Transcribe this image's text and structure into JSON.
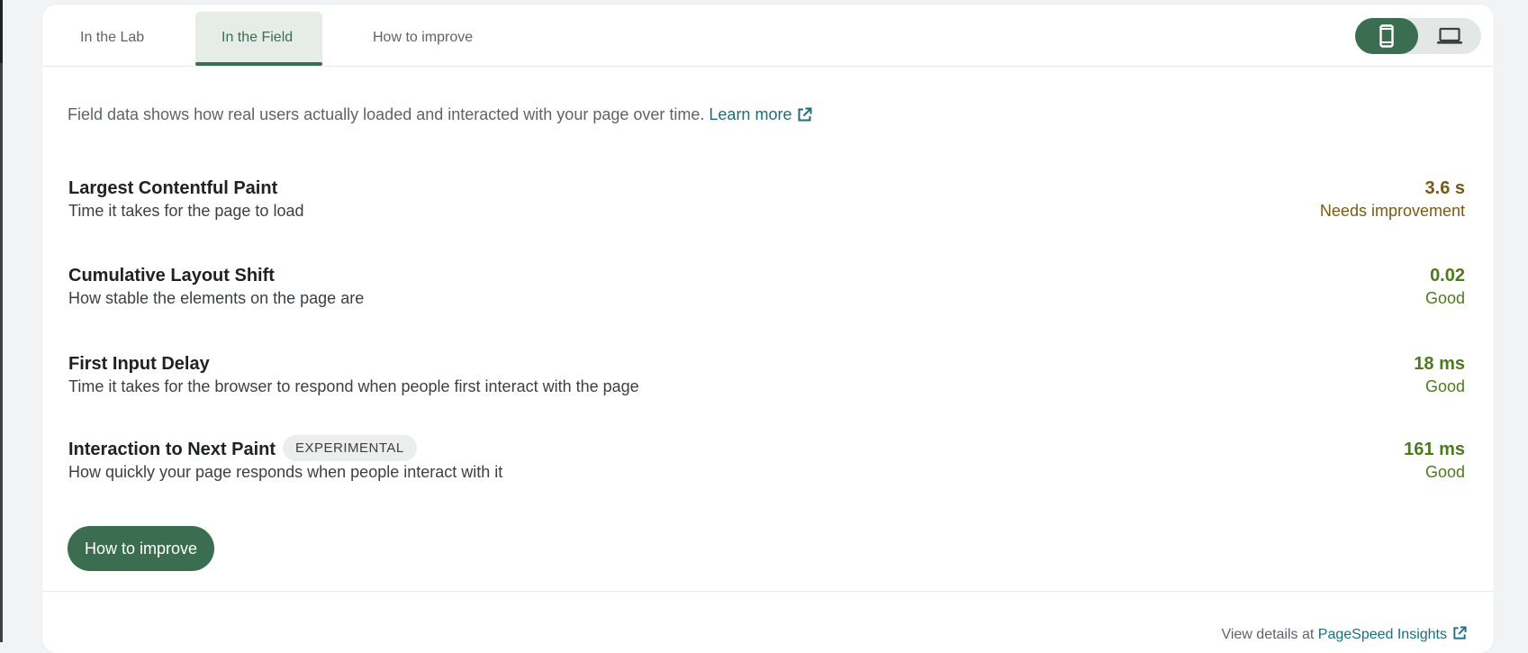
{
  "tabs": [
    {
      "label": "In the Lab"
    },
    {
      "label": "In the Field"
    },
    {
      "label": "How to improve"
    }
  ],
  "device_toggle": {
    "selected": "mobile",
    "options": [
      "mobile",
      "desktop"
    ]
  },
  "intro": {
    "text": "Field data shows how real users actually loaded and interacted with your page over time.",
    "link_label": "Learn more"
  },
  "metrics": [
    {
      "title": "Largest Contentful Paint",
      "description": "Time it takes for the page to load",
      "value": "3.6 s",
      "rating": "Needs improvement",
      "color": "#7a5a14"
    },
    {
      "title": "Cumulative Layout Shift",
      "description": "How stable the elements on the page are",
      "value": "0.02",
      "rating": "Good",
      "color": "#4e7a1e"
    },
    {
      "title": "First Input Delay",
      "description": "Time it takes for the browser to respond when people first interact with the page",
      "value": "18 ms",
      "rating": "Good",
      "color": "#4e7a1e"
    },
    {
      "title": "Interaction to Next Paint",
      "badge": "EXPERIMENTAL",
      "description": "How quickly your page responds when people interact with it",
      "value": "161 ms",
      "rating": "Good",
      "color": "#4e7a1e"
    }
  ],
  "cta": {
    "label": "How to improve"
  },
  "footer": {
    "prefix": "View details at",
    "link_label": "PageSpeed Insights"
  },
  "colors": {
    "accent": "#3b6e50",
    "link": "#1a6e80",
    "needs_improvement": "#7a5a14",
    "good": "#4e7a1e"
  }
}
